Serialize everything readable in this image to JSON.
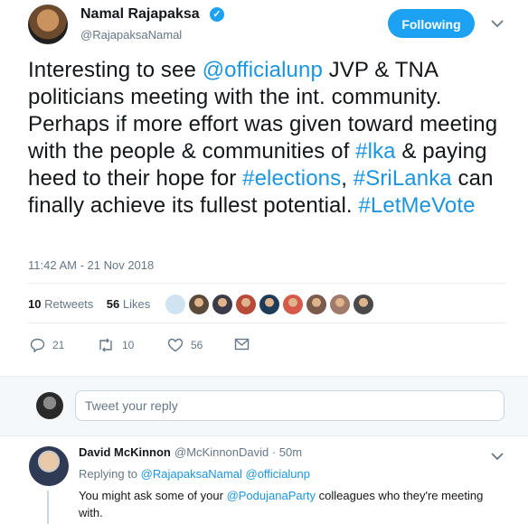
{
  "tweet": {
    "author_name": "Namal Rajapaksa",
    "author_handle": "@RajapaksaNamal",
    "follow_label": "Following",
    "text_parts": [
      {
        "t": "Interesting to see ",
        "link": false
      },
      {
        "t": "@officialunp",
        "link": true
      },
      {
        "t": " JVP & TNA politicians meeting with the int. community. Perhaps if more effort was given toward meeting with the people & communities of ",
        "link": false
      },
      {
        "t": "#lka",
        "link": true
      },
      {
        "t": " & paying heed to their hope for ",
        "link": false
      },
      {
        "t": "#elections",
        "link": true
      },
      {
        "t": ", ",
        "link": false
      },
      {
        "t": "#SriLanka",
        "link": true
      },
      {
        "t": " can finally achieve its fullest potential. ",
        "link": false
      },
      {
        "t": "#LetMeVote",
        "link": true
      }
    ],
    "timestamp": "11:42 AM - 21 Nov 2018",
    "retweets_count": "10",
    "retweets_label": "Retweets",
    "likes_count": "56",
    "likes_label": "Likes",
    "likers": [
      {
        "color": "#cfe3f0"
      },
      {
        "color": "#5a4a3a"
      },
      {
        "color": "#3b3b4a"
      },
      {
        "color": "#b84a3a"
      },
      {
        "color": "#1f3b5a"
      },
      {
        "color": "#d65a4a"
      },
      {
        "color": "#7a5a4a"
      },
      {
        "color": "#a07a6a"
      },
      {
        "color": "#4a4a4a"
      }
    ],
    "actions": {
      "reply_count": "21",
      "retweet_count": "10",
      "like_count": "56"
    }
  },
  "reply_box": {
    "placeholder": "Tweet your reply"
  },
  "reply": {
    "author_name": "David McKinnon",
    "meta": "@McKinnonDavid · 50m",
    "replying_to_label": "Replying to",
    "replying_to_1": "@RajapaksaNamal",
    "replying_to_2": "@officialunp",
    "text_before": "You might ask some of your ",
    "text_link": "@PodujanaParty",
    "text_after": " colleagues who they're meeting with."
  },
  "colors": {
    "accent": "#1da1f2",
    "link": "#1b95e0",
    "muted": "#657786"
  }
}
